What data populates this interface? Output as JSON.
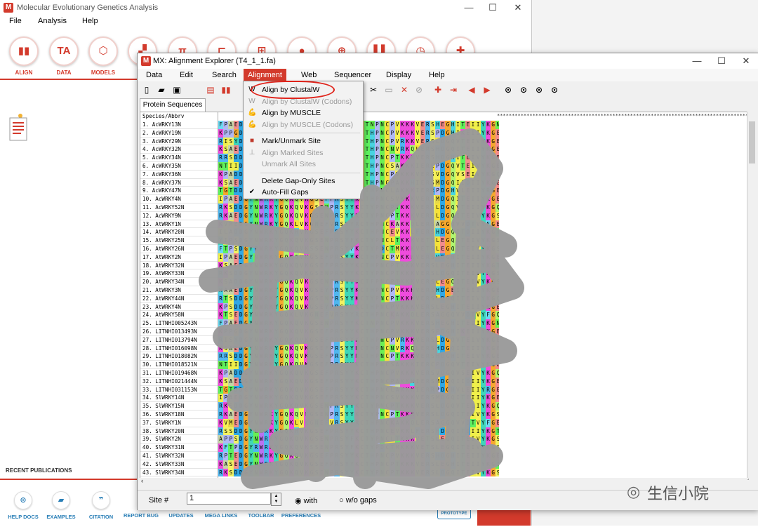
{
  "mega": {
    "title": "Molecular Evolutionary Genetics Analysis",
    "menu": [
      "File",
      "Analysis",
      "Help"
    ],
    "toolbar": [
      {
        "label": "ALIGN",
        "icon": "align-icon",
        "glyph": "▮▮"
      },
      {
        "label": "DATA",
        "icon": "data-icon",
        "glyph": "TA"
      },
      {
        "label": "MODELS",
        "icon": "models-icon",
        "glyph": "⬡"
      },
      {
        "label": "DIS",
        "icon": "distance-icon",
        "glyph": "▞"
      },
      {
        "label": "",
        "icon": "diversity-icon",
        "glyph": "π"
      },
      {
        "label": "",
        "icon": "phylogeny-icon",
        "glyph": "⊏"
      },
      {
        "label": "",
        "icon": "user-tree-icon",
        "glyph": "⊞"
      },
      {
        "label": "",
        "icon": "ancestors-icon",
        "glyph": "●"
      },
      {
        "label": "",
        "icon": "selection-icon",
        "glyph": "⊕"
      },
      {
        "label": "",
        "icon": "rates-icon",
        "glyph": "▌▌"
      },
      {
        "label": "",
        "icon": "clocks-icon",
        "glyph": "◷"
      },
      {
        "label": "",
        "icon": "diagnose-icon",
        "glyph": "✚"
      }
    ],
    "recent_publications": "RECENT PUBLICATIONS",
    "bottom_links": [
      {
        "label": "HELP DOCS",
        "icon": "help-docs-icon",
        "glyph": "⊙"
      },
      {
        "label": "EXAMPLES",
        "icon": "examples-icon",
        "glyph": "▰"
      },
      {
        "label": "CITATION",
        "icon": "citation-icon",
        "glyph": "❞"
      },
      {
        "label": "REPORT BUG",
        "icon": "report-bug-icon",
        "glyph": ""
      },
      {
        "label": "UPDATES",
        "icon": "updates-icon",
        "glyph": ""
      },
      {
        "label": "MEGA LINKS",
        "icon": "mega-links-icon",
        "glyph": ""
      },
      {
        "label": "TOOLBAR",
        "icon": "toolbar-icon",
        "glyph": ""
      },
      {
        "label": "PREFERENCES",
        "icon": "preferences-icon",
        "glyph": ""
      }
    ],
    "prototype": "PROTOTYPE"
  },
  "ae": {
    "title": "MX: Alignment Explorer (T4_1_1.fa)",
    "menu": [
      "Data",
      "Edit",
      "Search",
      "Alignment",
      "Web",
      "Sequencer",
      "Display",
      "Help"
    ],
    "active_menu": "Alignment",
    "tab": "Protein Sequences",
    "header": "Species/Abbrv",
    "names": [
      "1. AcWRKY13N",
      "2. AcWRKY19N",
      "3. AcWRKY29N",
      "4. AcWRKY32N",
      "5. AcWRKY34N",
      "6. AcWRKY35N",
      "7. AcWRKY36N",
      "8. AcWRKY37N",
      "9. AcWRKY47N",
      "10. AcWRKY4N",
      "11. AcWRKY52N",
      "12. AcWRKY9N",
      "13. AtWRKY1N",
      "14. AtWRKY20N",
      "15. AtWRKY25N",
      "16. AtWRKY26N",
      "17. AtWRKY2N",
      "18. AtWRKY32N",
      "19. AtWRKY33N",
      "20. AtWRKY34N",
      "21. AtWRKY3N",
      "22. AtWRKY44N",
      "23. AtWRKY4N",
      "24. AtWRKY58N",
      "25. LITNHI005243N",
      "26. LITNHI013493N",
      "27. LITNHI013794N",
      "28. LITNHI016098N",
      "29. LITNHI018082N",
      "30. LITNHI018521N",
      "31. LITNHI019468N",
      "32. LITNHI021444N",
      "33. LITNHI031153N",
      "34. SlWRKY14N",
      "35. SlWRKY15N",
      "36. SlWRKY18N",
      "37. SlWRKY1N",
      "38. SlWRKY20N",
      "39. SlWRKY2N",
      "40. SlWRKY31N",
      "41. SlWRKY32N",
      "42. SlWRKY33N",
      "43. SlWRKY34N"
    ],
    "sequences": [
      "FPAEDGYNWRKYGQKQVKGSENPRSYYKCTNPNCPVKKKVERSHEGHITEIIYKGNHNHPKP",
      "KPPGDGYNWRKYGQKQVKGSENPRSYYKCTHPNCPVKKKVERSPDGHIKEIIYKGEHNHQPS",
      "RISYDGYNWRKYGQKQVKGSEFPRSYYKCTHPNCPVRKKVERSLDGQVTEIVYKGEHNHPKP",
      "KSAEDGYNWRKYGQKQVKGSEFPRSYYKCTHPNCNVRKQLERSHDGQITEIIYKGEHDHPKP",
      "RRSDDGYNWRKYGQKQVKGSEFPRSYYKCTHPNCPTKKKVERSHDGHITEIVYKGEHNHPKP",
      "NTIIDGYNWRKYGQKQVKGSEFPRSYYKCTHPNCSAKKKIERCPDGQVTEIVYKGEHNHAAP",
      "KPADDGYNWRKYGQKQVKGSEFPRSYYKCTHPNCPVKKKVERSVDGQVSEIVYKGQHNHLRP",
      "KSAEDGYNWRKYGQKQVKGSEFPRSYYKCTHPNCPAKKHIERSMDGQIIDIIYKGEHDHPKP",
      "TGTDDGYNWRKYGQKQVKGSEFPRSYYKCTHPNCLAKKKIERRPDGHVLEIIYRGEHNHEPP",
      "IPAEDGYNWRKYGQKQVKGSEFPRSYYKCTHPNCSVKKKVERSMDGQITEIIYKGEHNHPKP",
      "RKSDDGYNWRKYGQKQVKGSENPRSYYKCTYPNCPTKKKVERSLDGQVTEIIYKGQHNHPKP",
      "RKAEDGYNWRKYGQKQVKGSENPRSYYKCTYPNCPTKKKVERSLDGQITEIVYKGSHNHPKP",
      "KVMEDGYNWRKYGQKLVKGNEFVRSYYRCTHPNCKAKKQLERSAGGQVVDTVYFGEHDHPKP",
      "ILADDGYNWRKYGQKHVKGSEFPRSYYKCTHPNCEVKKLFERSHDGQITDIIYKGTHDHPKP",
      "YIPSDGYNWRKYGQKQVKGSENPRSYFKCTYPNCLTKKKVETSLEGQITEIVYKGSHNHPKP",
      "FTPSDGYRWRKYGQKQVKSSENPRSYFKCTYPDCTMKKKVETSLEGQITEIVYKGSHNHPKP",
      "IPAEDGYNWRKYGQKQVKGSEFPRSYYKCTHPNCPVKKKVERSHDGHITEIIYKGEHNHPKP",
      "KSAEDGYNWRKYGQKQVKGSEFPRSYYKCTHPNCPTKKKVERSLEGHITEIIYKGTHNHPKP",
      "RKSDDGYNWRKYGQKQVKGSENPRSYYKCTYPNCPTKKKVERSLDGQITEIVYKGSHNHPKP",
      "KSADDGYNWRKYGQKQVKGSENPRSYYKCTFPNCPTKKKVERSLEGQITEIVYKGSHNHPKP",
      "HAAEDGYNWRKYGQKQVKGSEYPRSYYKCTHPNCPVKKKVERSHDGEITEIIYKGEHNHPKP",
      "RTSDDGYNWRKYGQKQVKGSENPRSYYKCTYPNCPTKKKVERSLDGQITEIVYKGQHNHPKP",
      "KPSDDGYNWRKYGQKQVKGSEYPRSYYKCTHPNCPVKKKVERSLEGHITEIIYKGEHNHEPP",
      "KTSEDGYNWRKYGQKLVKGNEFVRSYYRCTHPNCKAKKQLERSAGGQVVDTVYFGQHDHERP",
      "FPAEDGYNWRKYGQKQVKGSENPRSYYKCTNPNCPVKKKVERSHEGHITEIIYKGNHNHPKP",
      "KPPGDGYNWRKYGQKQVKGSEFPRSYYKCTHPNCPVKKKVERSPDGHIKEIIYKGEHNHQPS",
      "RISYDGYNWRKYGQKQVKGSEFPRSYYKCTHPNCPVRKKVERSLDGQVTEIVYKGEHNHPKP",
      "KSAEDGYNWRKYGQKQVKGSEFPRSYYKCTHPNCNVRKQLERSHDGQITEIIYKGEHDHPKP",
      "RRSDDGYNWRKYGQKQVKGSEFPRSYYKCTHPNCPTKKKVERSHDGHITEIVYKGEHNHPKP",
      "NTIIDGYNWRKYGQKQVKGSEFPRSYYKCTHPNCSAKKKIERCPDGQVTEIVYKGEHNHAAP",
      "KPADDGYNWRKYGQKQVKGSEFPRSYYKCTHPNCPVKKKVERSVDGQVSEIVYKGQHNHLRP",
      "KSAEDGYNWRKYGQKQVKGSEFPRSYYKCTHPNCPAKKHIERSMDGQIIDIIYKGEHDHPKP",
      "TGTDDGYNWRKYGQKQVKGSEFPRSYYKCTHPNCLAKKKIERRPDGHVLEIIYRGEHNHEPP",
      "IPAEDGYNWRKYGQKQVKGSEFPRSYYKCTHPNCSVKKKVERSMDGQITEIIYKGEHNHPKP",
      "RKSDDGYNWRKYGQKQVKGSENPRSYYKCTYPNCPTKKKVERSLDGQVTEIIYKGQHNHPKP",
      "RKAEDGYNWRKYGQKQVKGSENPRSYYKCTYPNCPTKKKVERSLDGQITEIVYKGSHNHPKP",
      "KVMEDGYNWRKYGQKLVKGNEFVRSYYRCTHPNCKAKKQLERSAGGQVVDTVYFGEHDHPKP",
      "RSSDDGYNWRKYGQKHVKGSEFPRSYYKCTHPNCEVKKLFERSHDGQITDIIYKGTHDHPKP",
      "APPSDGYNWRKYGQKQVKGSENPRSYFKCTYPNCLTKKKVETSLEGQITEIVYKGSHNHPKP",
      "KFTPDGYRWRKYGQKQVKSSENPRSYFKCTYPDCTMKKKVETSLEGQITEIVYKGSHNHPKP",
      "RPTEDGYNWRKYGQKQVKGSEFPRSYYKCTHPNCPVKKKVERSHDGHITEIIYKGEHNHPKP",
      "KASEDGYNWRKYGQKQVKGSEFPRSYYKCTHPNCPTKKKVERSLEGHITEIIYKGTHNHPKP",
      "RKSDDGYNWRKYGQKQVKGSENPRSYYKCTYPNCPTKKKVERSLDGQITEIVYKGSHNHPKP"
    ],
    "stars": "***********************************************************************************************",
    "dropdown": [
      {
        "label": "Align by ClustalW",
        "icon": "clustalw-icon",
        "glyph": "W",
        "disabled": false
      },
      {
        "label": "Align by ClustalW (Codons)",
        "icon": "clustalw-codons-icon",
        "glyph": "W",
        "disabled": true
      },
      {
        "label": "Align by MUSCLE",
        "icon": "muscle-icon",
        "glyph": "💪",
        "disabled": false
      },
      {
        "label": "Align by MUSCLE (Codons)",
        "icon": "muscle-codons-icon",
        "glyph": "💪",
        "disabled": true
      },
      {
        "sep": true
      },
      {
        "label": "Mark/Unmark Site",
        "icon": "mark-site-icon",
        "glyph": "■",
        "disabled": false
      },
      {
        "label": "Align Marked Sites",
        "icon": "align-marked-icon",
        "glyph": "⊥",
        "disabled": true
      },
      {
        "label": "Unmark All Sites",
        "icon": "",
        "glyph": "",
        "disabled": true
      },
      {
        "sep": true
      },
      {
        "label": "Delete Gap-Only Sites",
        "icon": "",
        "glyph": "",
        "disabled": false
      },
      {
        "label": "Auto-Fill Gaps",
        "icon": "check-icon",
        "glyph": "✔",
        "disabled": false
      }
    ],
    "status": {
      "site_label": "Site #",
      "site_value": "1",
      "with_label": "with",
      "without_label": "w/o gaps"
    }
  },
  "watermark": "生信小院",
  "colors": {
    "mega_red": "#d33a2c",
    "highlight_circle": "#e0241b",
    "scribble": "#9a9a9a"
  }
}
